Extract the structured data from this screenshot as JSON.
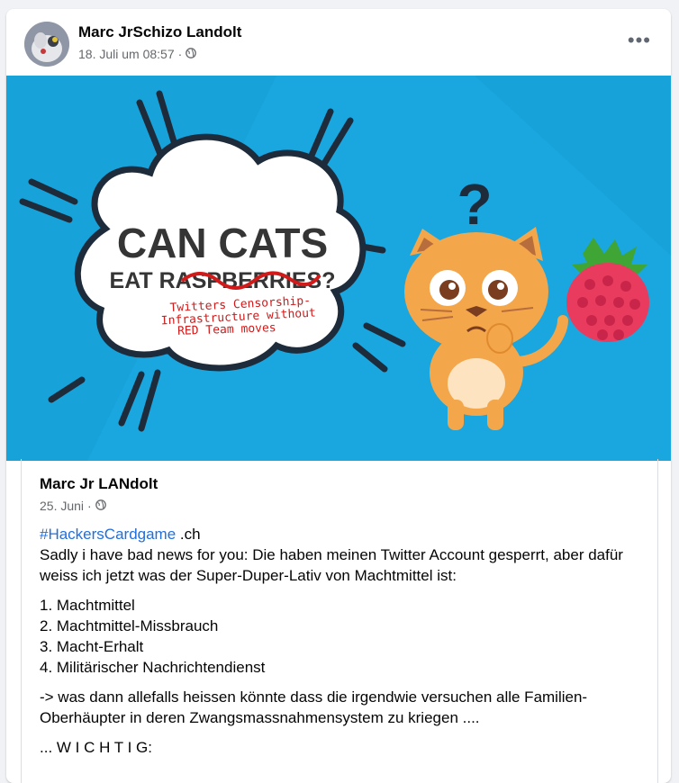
{
  "post": {
    "author": "Marc JrSchizo Landolt",
    "date": "18. Juli um 08:57",
    "separator": "·",
    "privacy_icon": "globe-icon",
    "more_icon": "more-options-icon",
    "more_label": "•••"
  },
  "image": {
    "headline": "CAN CATS",
    "subline": "EAT RASPBERRIES?",
    "scribble_line1": "Twitters Censorship-",
    "scribble_line2": "Infrastructure without",
    "scribble_line3": "RED Team moves",
    "question_mark": "?"
  },
  "shared_post": {
    "author": "Marc Jr LANdolt",
    "date": "25. Juni",
    "separator": "·",
    "privacy_icon": "globe-icon",
    "hashtag": "#HackersCardgame",
    "hashtag_suffix": " .ch",
    "paragraph1": "Sadly i have bad news for you: Die haben meinen Twitter Account gesperrt, aber dafür weiss ich jetzt was der Super-Duper-Lativ von Machtmittel ist:",
    "list": [
      "1. Machtmittel",
      "2. Machtmittel-Missbrauch",
      "3. Macht-Erhalt",
      "4. Militärischer Nachrichtendienst"
    ],
    "paragraph2": "-> was dann allefalls heissen könnte dass die irgendwie versuchen alle Familien-Oberhäupter in deren Zwangsmassnahmensystem zu kriegen ....",
    "paragraph3": "... W I C H T I G:"
  },
  "colors": {
    "hero_bg": "#1aa6df",
    "link": "#216fdb",
    "scribble": "#d11a1a",
    "cat": "#f4a64a",
    "raspberry": "#e83b5e"
  }
}
